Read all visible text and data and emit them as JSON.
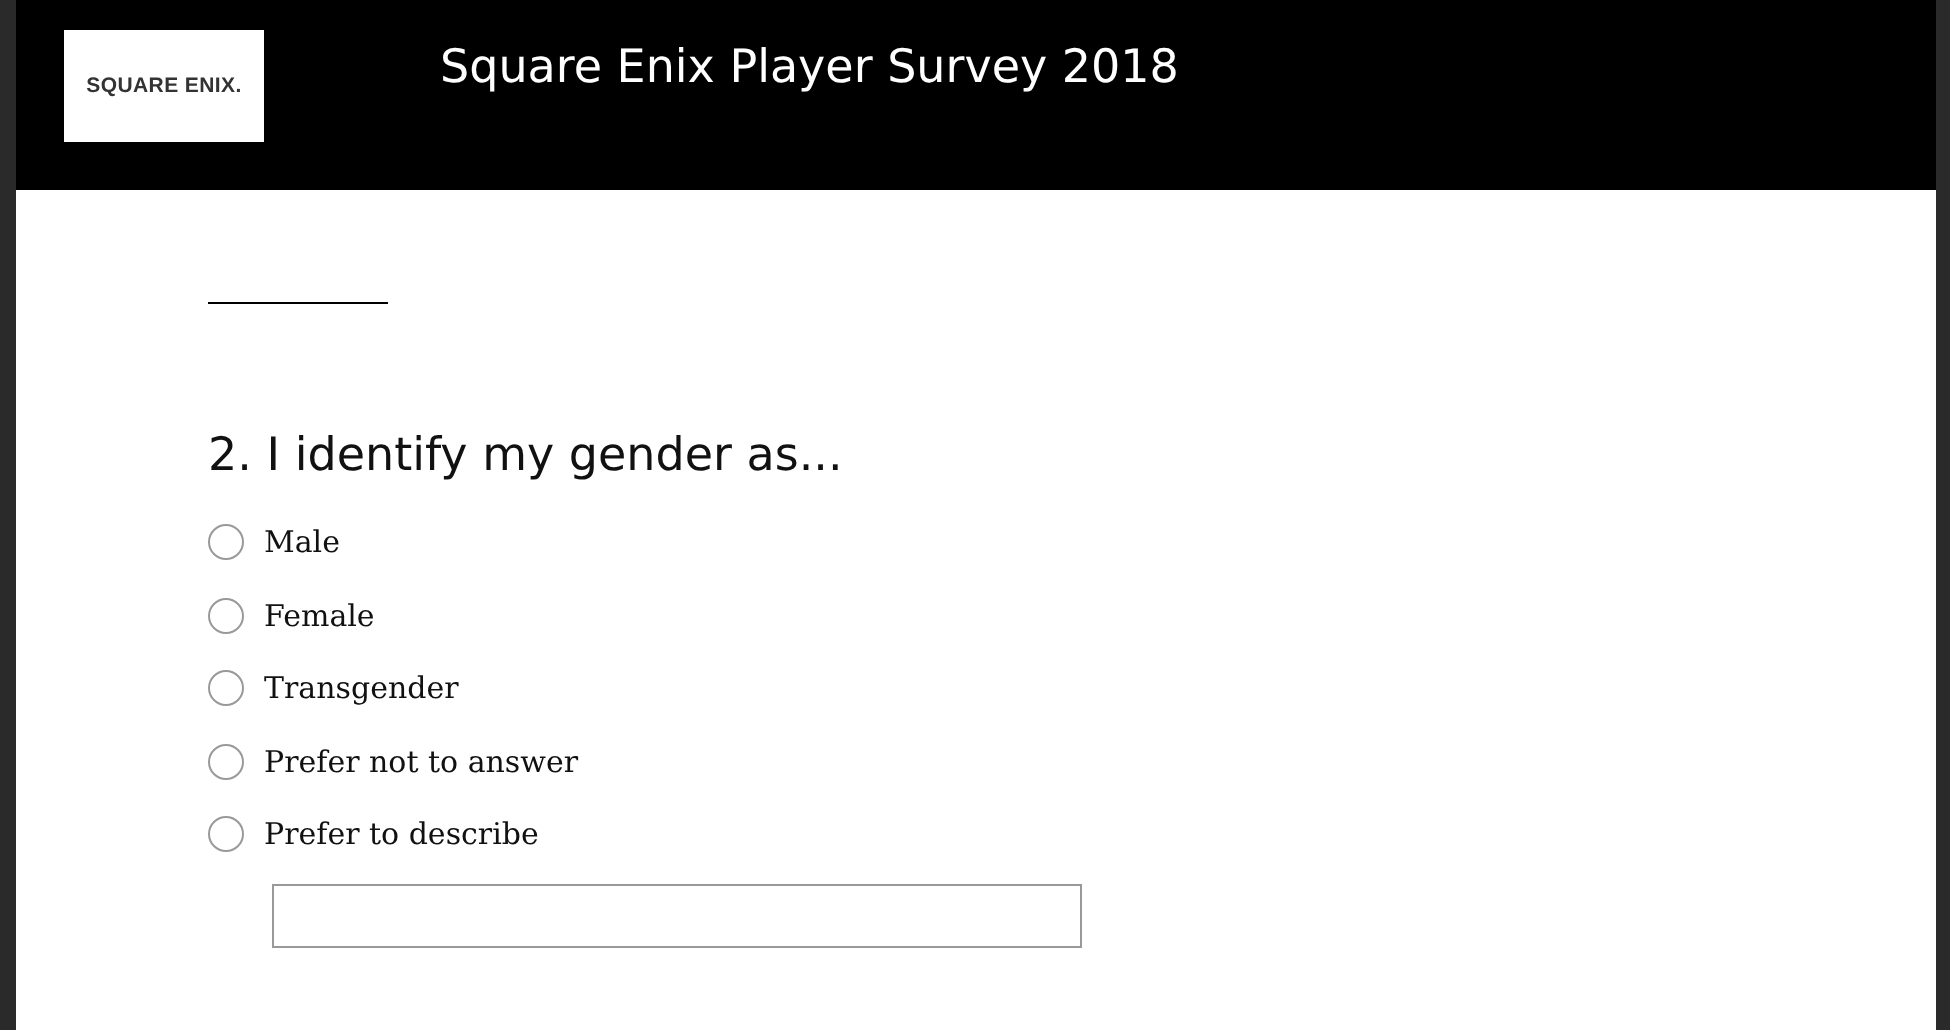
{
  "header": {
    "logo_text": "SQUARE ENIX.",
    "title": "Square Enix Player Survey 2018"
  },
  "question": {
    "title": "2. I identify my gender as...",
    "options": [
      {
        "label": "Male",
        "selected": false
      },
      {
        "label": "Female",
        "selected": false
      },
      {
        "label": "Transgender",
        "selected": false
      },
      {
        "label": "Prefer not to answer",
        "selected": false
      },
      {
        "label": "Prefer to describe",
        "selected": false
      }
    ]
  }
}
